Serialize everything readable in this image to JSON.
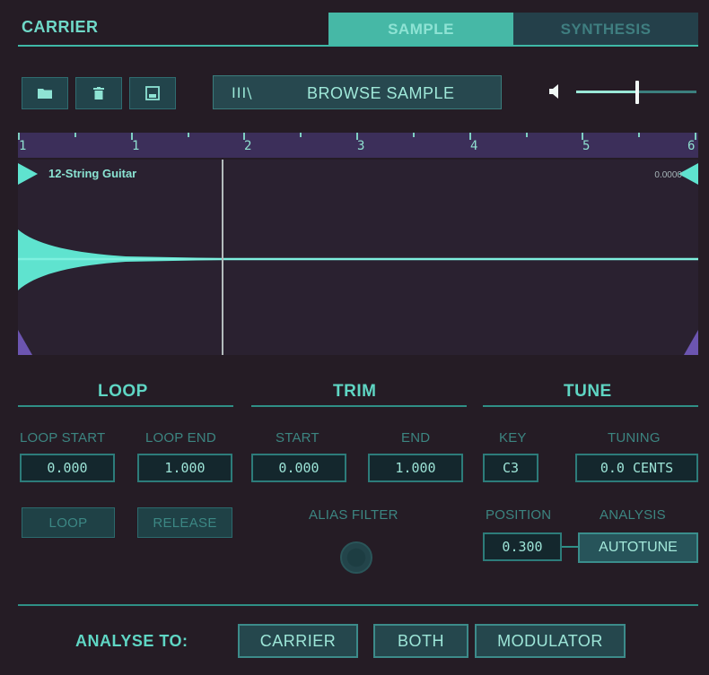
{
  "header": {
    "title": "CARRIER",
    "tabs": [
      {
        "label": "SAMPLE",
        "active": true
      },
      {
        "label": "SYNTHESIS",
        "active": false
      }
    ]
  },
  "toolbar": {
    "icons": [
      "folder-icon",
      "trash-icon",
      "save-icon"
    ],
    "browse_icon": "library-icon",
    "browse_glyph": "III\\",
    "browse_label": "BROWSE SAMPLE",
    "volume_icon": "speaker-icon",
    "volume_level": 0.51
  },
  "ruler": {
    "ticks": [
      "1",
      "1",
      "2",
      "3",
      "4",
      "5",
      "6"
    ]
  },
  "waveform": {
    "sample_name": "12-String Guitar",
    "end_value": "0.0000",
    "playhead_position": 0.3
  },
  "loop": {
    "title": "LOOP",
    "start_label": "LOOP START",
    "start_value": "0.000",
    "end_label": "LOOP END",
    "end_value": "1.000",
    "loop_button": "LOOP",
    "release_button": "RELEASE"
  },
  "trim": {
    "title": "TRIM",
    "start_label": "START",
    "start_value": "0.000",
    "end_label": "END",
    "end_value": "1.000",
    "alias_filter_label": "ALIAS FILTER"
  },
  "tune": {
    "title": "TUNE",
    "key_label": "KEY",
    "key_value": "C3",
    "tuning_label": "TUNING",
    "tuning_value": "0.0 CENTS",
    "position_label": "POSITION",
    "position_value": "0.300",
    "analysis_label": "ANALYSIS",
    "analysis_button": "AUTOTUNE"
  },
  "footer": {
    "label": "ANALYSE TO:",
    "buttons": [
      "CARRIER",
      "BOTH",
      "MODULATOR"
    ]
  },
  "colors": {
    "accent": "#46b8a6",
    "waveform": "#5fe3cf",
    "background": "#251c25",
    "ruler": "#3c2f5a"
  }
}
